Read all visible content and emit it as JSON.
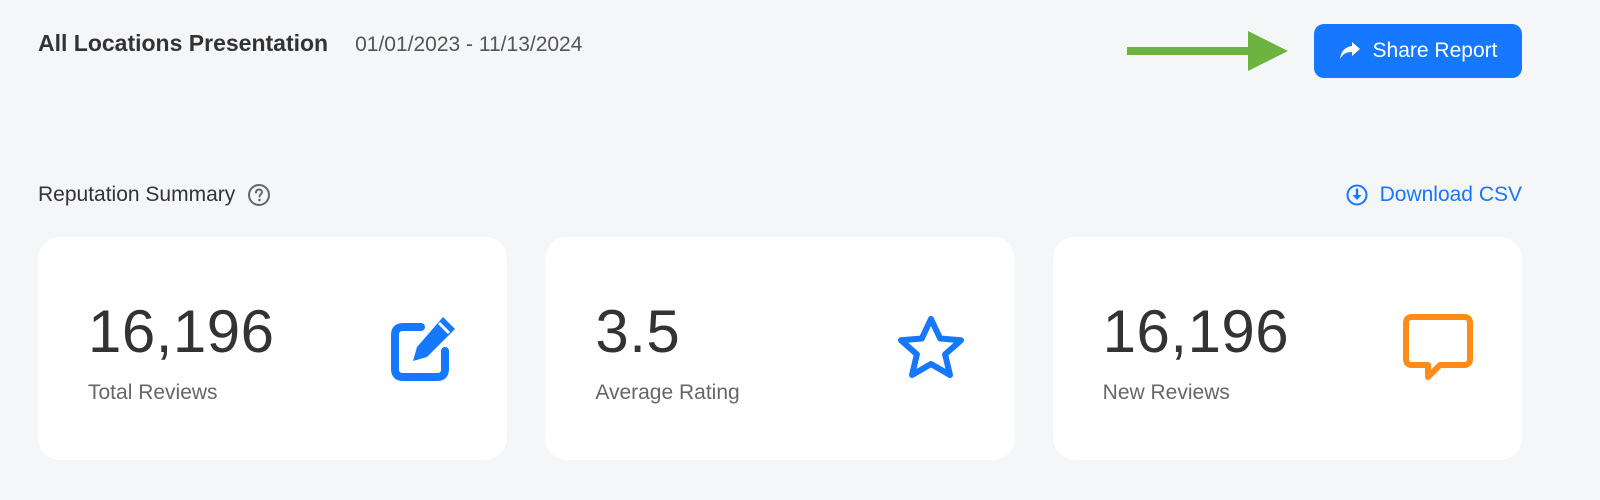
{
  "header": {
    "title": "All Locations Presentation",
    "date_range": "01/01/2023 - 11/13/2024",
    "share_label": "Share Report"
  },
  "summary": {
    "title": "Reputation Summary",
    "download_label": "Download CSV"
  },
  "cards": [
    {
      "value": "16,196",
      "label": "Total Reviews",
      "icon": "edit-icon"
    },
    {
      "value": "3.5",
      "label": "Average Rating",
      "icon": "star-icon"
    },
    {
      "value": "16,196",
      "label": "New Reviews",
      "icon": "comment-icon"
    }
  ],
  "colors": {
    "accent": "#1677ff",
    "arrow": "#6db33f",
    "comment": "#ff8c1a",
    "background": "#f5f6f8"
  }
}
